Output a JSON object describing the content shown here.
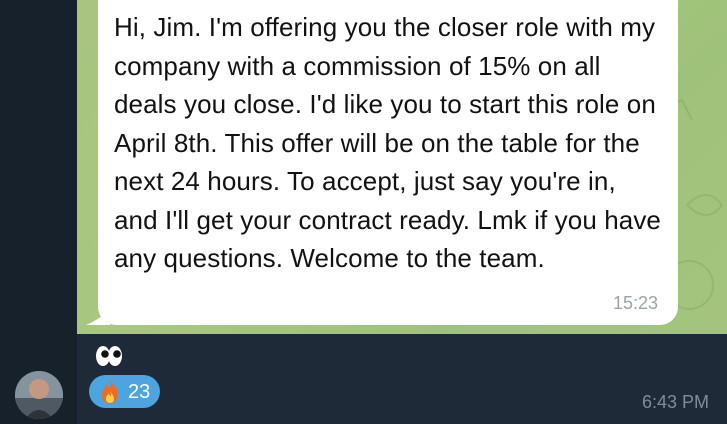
{
  "message": {
    "text": "Hi, Jim. I'm offering you the closer role with my company with a commission of 15% on all deals you close. I'd like you to start this role on April 8th. This offer will be on the table for the next 24 hours. To accept, just say you're in, and I'll get your contract ready. Lmk if you have any questions. Welcome to the team.",
    "time": "15:23"
  },
  "reaction": {
    "icon": "fire-icon",
    "count": "23"
  },
  "decorations": {
    "eyes_icon": "eyes-icon"
  },
  "post": {
    "time": "6:43 PM"
  },
  "colors": {
    "background": "#17212b",
    "wallpaper": "#a8c47e",
    "bubble": "#ffffff",
    "reaction_bg": "#4ea4df",
    "time_text": "#7f8c99"
  }
}
